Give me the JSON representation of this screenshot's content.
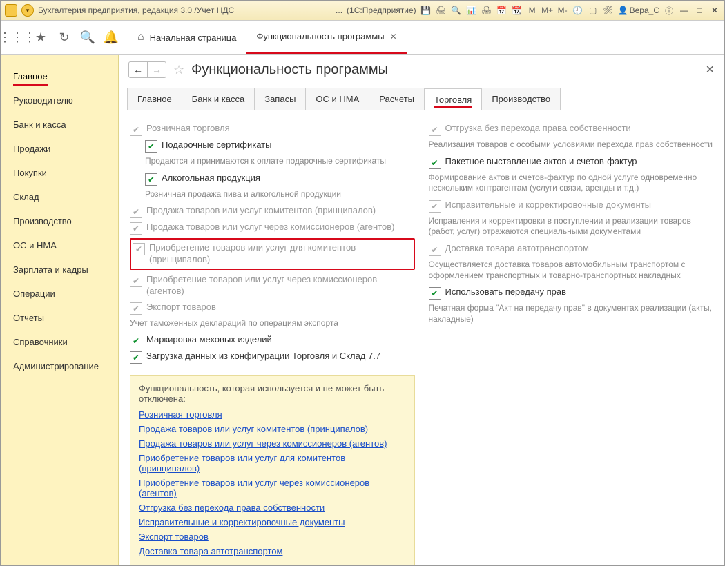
{
  "titlebar": {
    "title": "Бухгалтерия предприятия, редакция 3.0 /Учет НДС",
    "truncated": "...",
    "context": "(1С:Предприятие)",
    "user": "Вера_С",
    "m_labels": [
      "M",
      "M+",
      "M-"
    ]
  },
  "tabs": {
    "home": "Начальная страница",
    "active": "Функциональность программы"
  },
  "sidebar": [
    "Главное",
    "Руководителю",
    "Банк и касса",
    "Продажи",
    "Покупки",
    "Склад",
    "Производство",
    "ОС и НМА",
    "Зарплата и кадры",
    "Операции",
    "Отчеты",
    "Справочники",
    "Администрирование"
  ],
  "page": {
    "title": "Функциональность программы"
  },
  "subtabs": [
    "Главное",
    "Банк и касса",
    "Запасы",
    "ОС и НМА",
    "Расчеты",
    "Торговля",
    "Производство"
  ],
  "left": {
    "r1": "Розничная торговля",
    "r2": "Подарочные сертификаты",
    "r2d": "Продаются и принимаются к оплате подарочные сертификаты",
    "r3": "Алкогольная продукция",
    "r3d": "Розничная продажа пива и алкогольной продукции",
    "r4": "Продажа товаров или услуг комитентов (принципалов)",
    "r5": "Продажа товаров или услуг через комиссионеров (агентов)",
    "r6": "Приобретение товаров или услуг для комитентов (принципалов)",
    "r7": "Приобретение товаров или услуг через комиссионеров (агентов)",
    "r8": "Экспорт товаров",
    "r8d": "Учет таможенных деклараций по операциям экспорта",
    "r9": "Маркировка меховых изделий",
    "r10": "Загрузка данных из конфигурации Торговля и Склад 7.7"
  },
  "right": {
    "r1": "Отгрузка без перехода права собственности",
    "r1d": "Реализация товаров с особыми условиями перехода прав собственности",
    "r2": "Пакетное выставление актов и счетов-фактур",
    "r2d": "Формирование актов и счетов-фактур по одной услуге одновременно нескольким контрагентам (услуги связи, аренды и т.д.)",
    "r3": "Исправительные и корректировочные документы",
    "r3d": "Исправления и корректировки в поступлении и реализации товаров (работ, услуг) отражаются специальными документами",
    "r4": "Доставка товара автотранспортом",
    "r4d": "Осуществляется доставка товаров автомобильным транспортом с оформлением транспортных и товарно-транспортных накладных",
    "r5": "Использовать передачу прав",
    "r5d": "Печатная форма \"Акт на передачу прав\" в документах реализации (акты, накладные)"
  },
  "infobox": {
    "header": "Функциональность, которая используется и не может быть отключена:",
    "links": [
      "Розничная торговля",
      "Продажа товаров или услуг комитентов (принципалов)",
      "Продажа товаров или услуг через комиссионеров (агентов)",
      "Приобретение товаров или услуг для комитентов (принципалов)",
      "Приобретение товаров или услуг через комиссионеров (агентов)",
      "Отгрузка без перехода права собственности",
      "Исправительные и корректировочные документы",
      "Экспорт товаров",
      "Доставка товара автотранспортом"
    ]
  }
}
